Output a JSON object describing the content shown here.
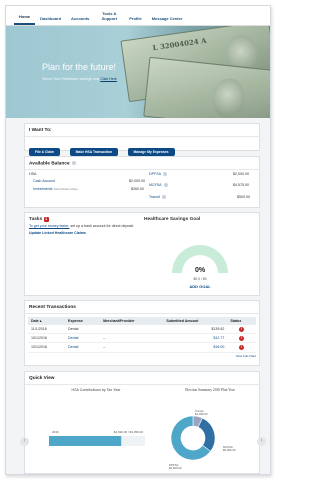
{
  "nav": {
    "tabs": [
      {
        "label": "Home"
      },
      {
        "label": "Dashboard"
      },
      {
        "label": "Accounts"
      },
      {
        "label": "Tools & Support"
      },
      {
        "label": "Profile"
      },
      {
        "label": "Message Center"
      }
    ]
  },
  "hero": {
    "title": "Plan for the future!",
    "subtitle": "Select Your Healthcare savings now ",
    "link": "Click Here",
    "bill_serial": "L 32004024 A"
  },
  "want": {
    "heading": "I Want To:",
    "buttons": [
      "File A Claim",
      "Make HSA Transaction",
      "Manage My Expenses"
    ]
  },
  "balance": {
    "heading": "Available Balance",
    "left": [
      {
        "label": "HSA",
        "value": ""
      },
      {
        "label": "Cash Account",
        "value": "$2,000.00"
      },
      {
        "label": "Investments",
        "sub": "Total Market Value",
        "value": "$260.00"
      }
    ],
    "right": [
      {
        "label": "DPFSA",
        "value": "$2,000.00"
      },
      {
        "label": "MCFSA",
        "value": "$4,575.00"
      },
      {
        "label": "Transit",
        "value": "$500.00"
      }
    ]
  },
  "tasks": {
    "heading": "Tasks",
    "count": "1",
    "text_link": "To get your money faster,",
    "text_rest": " set up a bank account for direct deposit.",
    "link2": "Update Linked Healthcare Claims"
  },
  "goal": {
    "heading": "Healthcare Savings Goal",
    "percent": "0%",
    "fraction": 0,
    "amount": "$0.0 / $0",
    "add": "ADD GOAL"
  },
  "transactions": {
    "heading": "Recent Transactions",
    "columns": [
      "Date",
      "Expense",
      "Merchant/Provider",
      "Submitted Amount",
      "Status"
    ],
    "rows": [
      {
        "date": "11/1/2016",
        "expense": "Dental",
        "merchant": "",
        "amount": "$139.82"
      },
      {
        "date": "10/1/2016",
        "expense": "Dental",
        "merchant": "--",
        "amount": "$12.77"
      },
      {
        "date": "10/1/2016",
        "expense": "Dental",
        "merchant": "--",
        "amount": "$16.00"
      }
    ],
    "status_glyph": "!",
    "view_all": "View Full Chart"
  },
  "quick": {
    "heading": "Quick View",
    "chart1_title": "HSA Contributions by Tax Year",
    "chart2_title": "Election Summary 2016 Plan Year",
    "prev_arrow": "‹",
    "next_arrow": "›"
  },
  "chart_data": [
    {
      "type": "bar",
      "title": "HSA Contributions by Tax Year",
      "categories": [
        "2016"
      ],
      "values": [
        2520
      ],
      "labels": [
        "$2,520.00 / $3,350.00"
      ],
      "orientation": "horizontal",
      "xlim": [
        0,
        3350
      ]
    },
    {
      "type": "pie",
      "title": "Election Summary 2016 Plan Year",
      "categories": [
        "Transit",
        "DPFSA",
        "MCFSA"
      ],
      "values": [
        500,
        2000,
        4575
      ],
      "slice_labels": [
        "Transit $1,000.00",
        "DPFSA $2,000.00",
        "MCFSA $5,000.00"
      ],
      "colors": [
        "#9aa3c4",
        "#2f6fa3",
        "#4ea6c9"
      ]
    }
  ],
  "colors": {
    "primary": "#0d4a85",
    "alert": "#c62828",
    "gauge": "#c9ecd8"
  }
}
